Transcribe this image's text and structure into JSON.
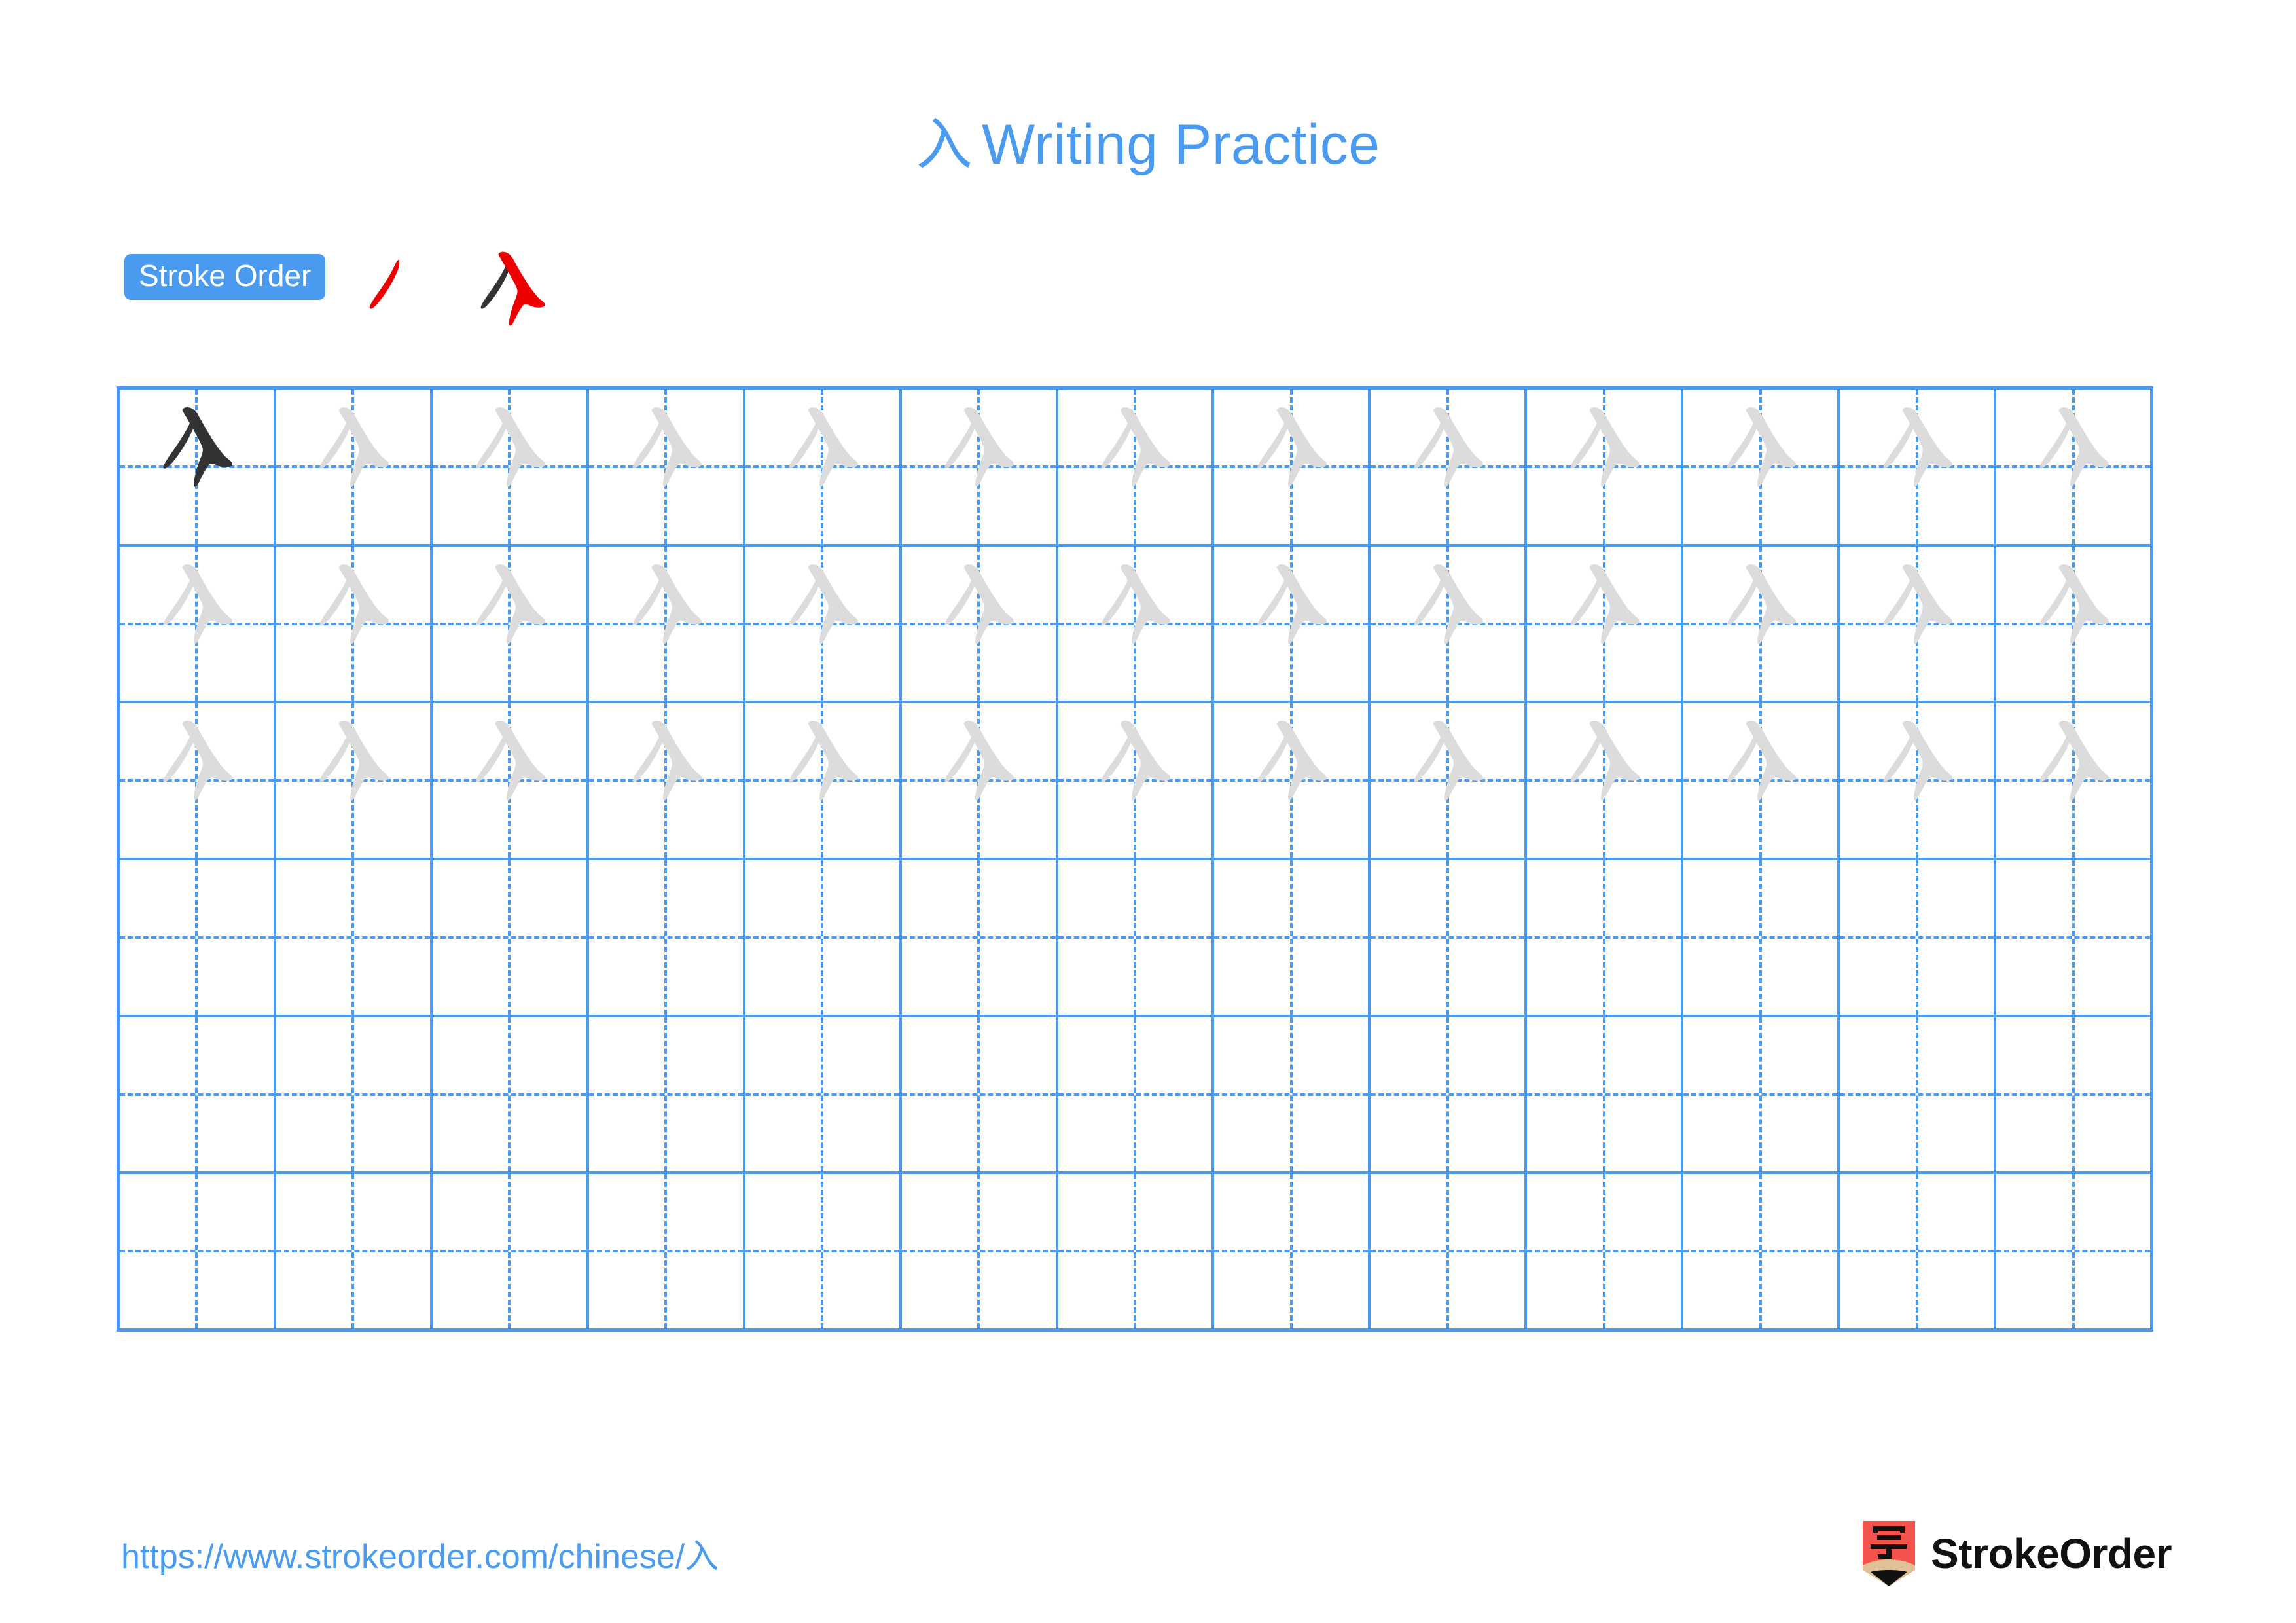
{
  "character": "入",
  "title": {
    "character": "入",
    "text": "Writing Practice",
    "color": "#4a9bf0"
  },
  "stroke_order": {
    "badge_label": "Stroke Order",
    "badge_bg": "#4a9bf0",
    "badge_text_color": "#ffffff",
    "stroke_count": 2,
    "new_stroke_color": "#ee0000",
    "existing_stroke_color": "#333333",
    "steps": [
      {
        "step": 1,
        "new_stroke": 1,
        "previous_strokes": 0,
        "stroke_name": "piě"
      },
      {
        "step": 2,
        "new_stroke": 2,
        "previous_strokes": 1,
        "stroke_name": "nà"
      }
    ]
  },
  "grid": {
    "columns": 13,
    "rows": 6,
    "line_color": "#4a9bf0",
    "guide_style": "dashed-crosshair",
    "model_glyph_color": "#333333",
    "trace_glyph_color": "#dcdcdc",
    "row_fill": [
      {
        "row": 1,
        "model_cells": 1,
        "trace_cells": 12,
        "blank_cells": 0
      },
      {
        "row": 2,
        "model_cells": 0,
        "trace_cells": 13,
        "blank_cells": 0
      },
      {
        "row": 3,
        "model_cells": 0,
        "trace_cells": 13,
        "blank_cells": 0
      },
      {
        "row": 4,
        "model_cells": 0,
        "trace_cells": 0,
        "blank_cells": 13
      },
      {
        "row": 5,
        "model_cells": 0,
        "trace_cells": 0,
        "blank_cells": 13
      },
      {
        "row": 6,
        "model_cells": 0,
        "trace_cells": 0,
        "blank_cells": 13
      }
    ]
  },
  "footer": {
    "url": "https://www.strokeorder.com/chinese/入",
    "url_color": "#4a9bf0",
    "brand_name": "StrokeOrder",
    "logo_character": "字",
    "logo_body_color": "#f4524d",
    "logo_tip_color": "#e0c096",
    "logo_point_color": "#111111"
  }
}
